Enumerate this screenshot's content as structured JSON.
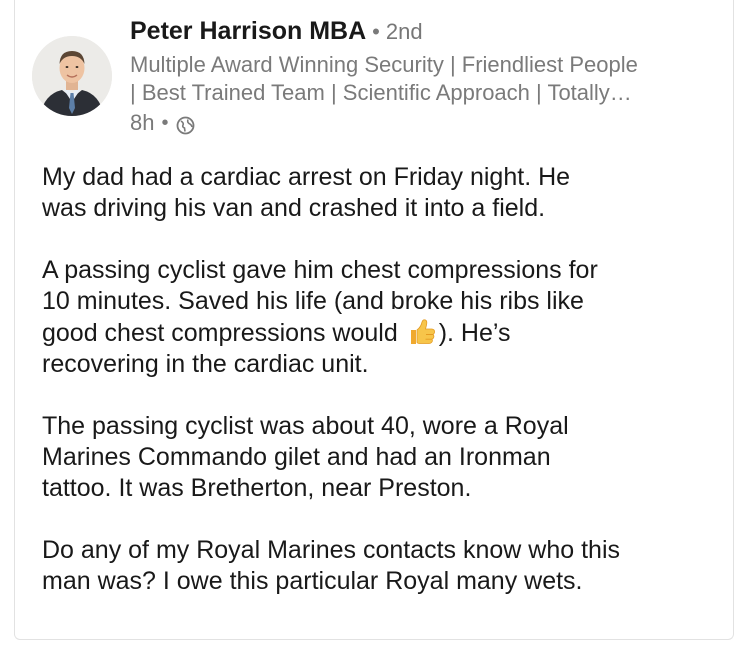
{
  "post": {
    "author": {
      "name": "Peter Harrison MBA",
      "separator": "•",
      "connection_degree": "2nd",
      "headline_line1": "Multiple Award Winning Security | Friendliest People",
      "headline_line2": "| Best Trained Team | Scientific Approach | Totally…"
    },
    "time": "8h",
    "time_separator": "•",
    "visibility_icon": "globe-icon",
    "paragraphs": [
      {
        "lines": [
          "My dad had a cardiac arrest on Friday night.  He",
          "was driving his van and crashed it into a field."
        ]
      },
      {
        "lines": [
          "A passing cyclist gave him chest compressions for",
          "10 minutes.  Saved his life (and broke his ribs like"
        ],
        "line3_before": "good chest compressions would ",
        "line3_emoji": "thumbs-up-emoji",
        "line3_after": ").  He’s",
        "line4": "recovering in the cardiac unit."
      },
      {
        "lines": [
          "The passing cyclist was about 40, wore a Royal",
          "Marines Commando gilet and had an Ironman",
          "tattoo.  It was Bretherton, near Preston."
        ]
      },
      {
        "lines": [
          "Do any of my Royal Marines contacts know who this",
          "man was?  I owe this particular Royal many wets."
        ]
      }
    ]
  },
  "colors": {
    "text": "#191919",
    "secondary_text": "#7a7a7a",
    "border": "#e2e2e2",
    "emoji": "#f5c04a"
  }
}
